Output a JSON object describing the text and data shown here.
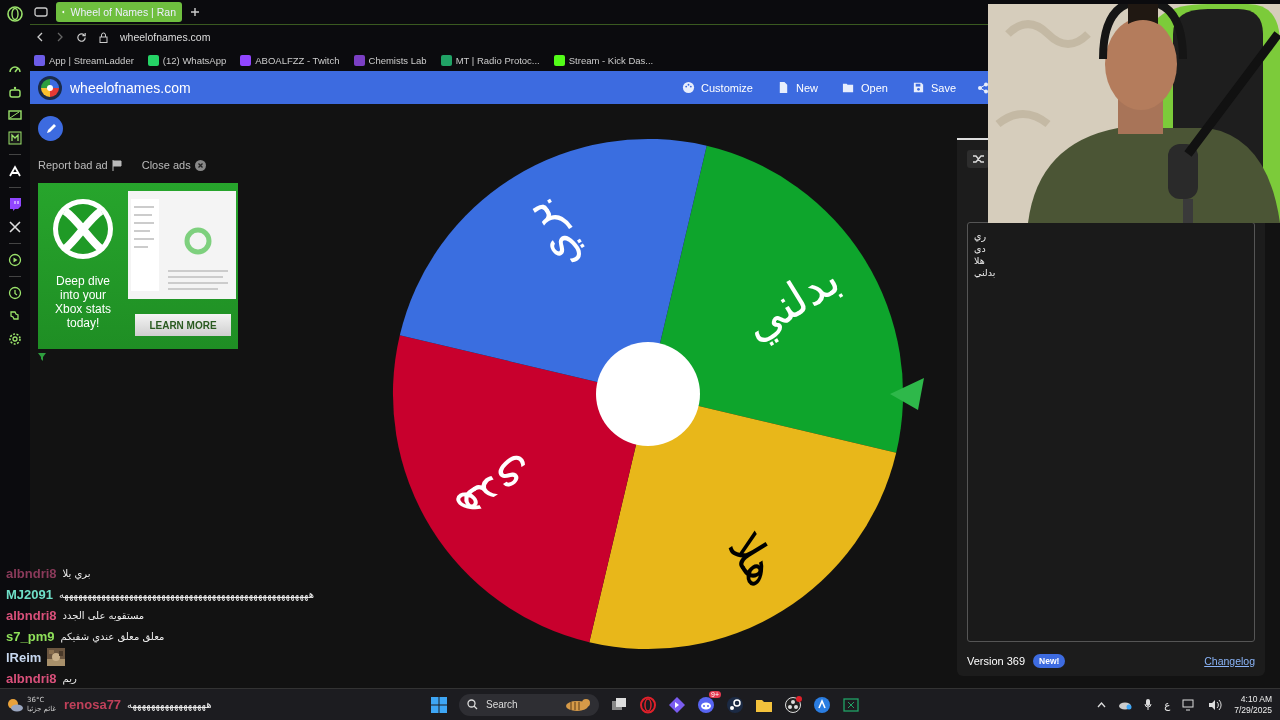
{
  "browser": {
    "tab_title": "Wheel of Names | Ran",
    "tab_selected": true,
    "url": "wheelofnames.com",
    "bookmarks": [
      {
        "label": "App | StreamLadder",
        "color": "#6c5ce7"
      },
      {
        "label": "(12) WhatsApp",
        "color": "#25d366"
      },
      {
        "label": "ABOALFZZ - Twitch",
        "color": "#9146ff"
      },
      {
        "label": "Chemists Lab",
        "color": "#7b3fc4"
      },
      {
        "label": "MT | Radio Protoc...",
        "color": "#21a366"
      },
      {
        "label": "Stream - Kick Das...",
        "color": "#53fc18"
      }
    ]
  },
  "site": {
    "logo_text": "wheelofnames.com",
    "toolbar": [
      {
        "kind": "customize",
        "label": "Customize"
      },
      {
        "kind": "new",
        "label": "New"
      },
      {
        "kind": "open",
        "label": "Open"
      },
      {
        "kind": "save",
        "label": "Save"
      }
    ]
  },
  "ad": {
    "report": "Report bad ad",
    "close": "Close ads",
    "headline": "Deep dive into your Xbox stats today!",
    "button": "LEARN MORE"
  },
  "wheel": {
    "segments": [
      {
        "label": "بدلني",
        "color": "#0ea52c"
      },
      {
        "label": "هلا",
        "color": "#e8b71a"
      },
      {
        "label": "هدى",
        "color": "#c8002d"
      },
      {
        "label": "بري",
        "color": "#3a6ee0"
      }
    ]
  },
  "entries": [
    "ري",
    "دى",
    "هلا",
    "بدلني"
  ],
  "footer": {
    "version": "Version 369",
    "badge": "New!",
    "link": "Changelog"
  },
  "chat": [
    {
      "user": "albndri8",
      "color": "#8a3a5a",
      "message": "بري يلا"
    },
    {
      "user": "MJ2091",
      "color": "#6fe0c8",
      "message": "ههههههههههههههههههههههههههههههههههههههههههههههههههههههه"
    },
    {
      "user": "albndri8",
      "color": "#d9507a",
      "message": "مستقويه على الجدد"
    },
    {
      "user": "s7_pm9",
      "color": "#8fe05a",
      "message": "معلق معلق عندي شفيكم"
    },
    {
      "user": "lReim",
      "color": "#c8d8f0",
      "kind": "emote"
    },
    {
      "user": "albndri8",
      "color": "#d9507a",
      "message": "ريم"
    },
    {
      "user": "renosa77",
      "color": "#c0405a",
      "message": "هههههههههههههههههه"
    }
  ],
  "weather": {
    "temp": "36°C",
    "condition": "غائم جزئيا"
  },
  "taskbar": {
    "search": "Search",
    "badge": "9+",
    "language": "ع",
    "time": "4:10 AM",
    "date": "7/29/2025"
  }
}
